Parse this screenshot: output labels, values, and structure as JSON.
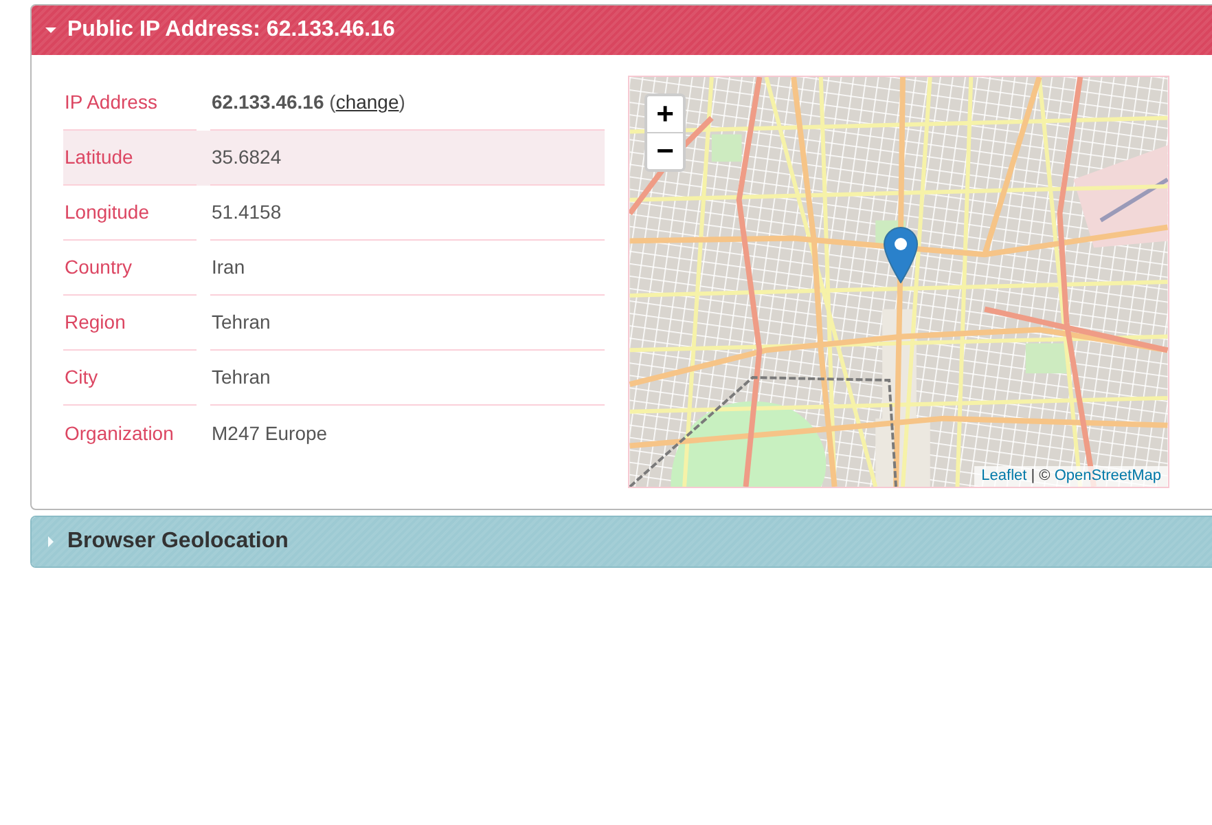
{
  "panels": [
    {
      "kind": "danger",
      "title": "Public IP Address: 62.133.46.16",
      "expanded": true,
      "rows": [
        {
          "label": "IP Address",
          "value": "**62.133.46.16** (",
          "link": "change",
          "value_end": ")",
          "hovered": false
        },
        {
          "label": "Latitude",
          "value": "35.6824",
          "hovered": true
        },
        {
          "label": "Longitude",
          "value": "51.4158",
          "hovered": false
        },
        {
          "label": "Country",
          "value": "Iran",
          "hovered": false
        },
        {
          "label": "Region",
          "value": "Tehran",
          "hovered": false
        },
        {
          "label": "City",
          "value": "Tehran",
          "hovered": false
        },
        {
          "label": "Organization",
          "value": "M247 Europe",
          "hovered": false
        }
      ],
      "map": {
        "zoom_in": "+",
        "zoom_out": "−",
        "attribution": {
          "links": [
            "Leaflet",
            "OpenStreetMap"
          ],
          "separator": " | © "
        }
      }
    },
    {
      "kind": "info",
      "title": "Browser Geolocation",
      "expanded": false
    }
  ]
}
